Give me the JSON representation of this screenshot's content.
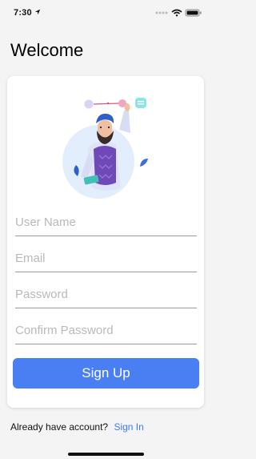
{
  "status_bar": {
    "time": "7:30",
    "location_icon": "location-arrow-icon",
    "signal_icon": "signal-dots-icon",
    "wifi_icon": "wifi-icon",
    "battery_icon": "battery-icon"
  },
  "page": {
    "title": "Welcome"
  },
  "form": {
    "illustration": "person-with-phone-illustration",
    "username_placeholder": "User Name",
    "email_placeholder": "Email",
    "password_placeholder": "Password",
    "confirm_password_placeholder": "Confirm Password",
    "signup_label": "Sign Up"
  },
  "footer": {
    "prompt": "Already have account?",
    "signin_label": "Sign In"
  },
  "colors": {
    "accent": "#4a7ff3",
    "link": "#3d7bf2",
    "background": "#f4f4f4",
    "card": "#ffffff"
  }
}
